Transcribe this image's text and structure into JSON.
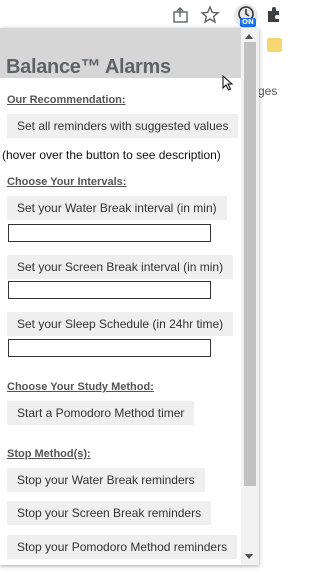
{
  "toolbar": {
    "icons": [
      "share-icon",
      "star-icon",
      "extension-icon",
      "puzzle-icon"
    ],
    "extension_badge": "ON"
  },
  "background_page": {
    "text": "ges"
  },
  "popup": {
    "title": "Balance™ Alarms",
    "sections": {
      "recommendation": {
        "heading": "Our Recommendation:",
        "button": "Set all reminders with suggested values",
        "hint": "(hover over the button to see description)"
      },
      "intervals": {
        "heading": "Choose Your Intervals:",
        "water_button": "Set your Water Break interval (in min)",
        "water_value": "",
        "screen_button": "Set your Screen Break interval (in min)",
        "screen_value": "",
        "sleep_button": "Set your Sleep Schedule (in 24hr time)",
        "sleep_value": ""
      },
      "study": {
        "heading": "Choose Your Study Method:",
        "pomodoro_button": "Start a Pomodoro Method timer"
      },
      "stop": {
        "heading": "Stop Method(s):",
        "water_button": "Stop your Water Break reminders",
        "screen_button": "Stop your Screen Break reminders",
        "pomodoro_button": "Stop your Pomodoro Method reminders"
      }
    }
  },
  "colors": {
    "header_bg": "#d6d6d6",
    "button_bg": "#efefef",
    "badge": "#1a73e8"
  }
}
